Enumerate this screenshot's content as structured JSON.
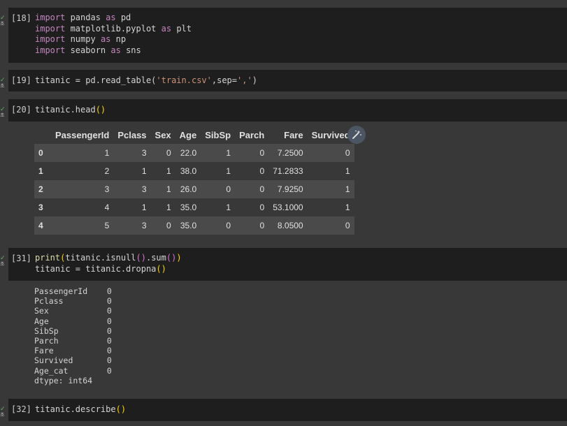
{
  "cells": [
    {
      "prompt": "[18]",
      "status": "✓",
      "time": "초",
      "lines": [
        [
          "import",
          " pandas ",
          "as",
          " pd"
        ],
        [
          "import",
          " matplotlib.pyplot ",
          "as",
          " plt"
        ],
        [
          "import",
          " numpy ",
          "as",
          " np"
        ],
        [
          "import",
          " seaborn ",
          "as",
          " sns"
        ]
      ]
    },
    {
      "prompt": "[19]",
      "status": "✓",
      "time": "초",
      "code_pre": "titanic = pd.read_table(",
      "code_str1": "'train.csv'",
      "code_mid": ",sep=",
      "code_str2": "','",
      "code_post": ")"
    },
    {
      "prompt": "[20]",
      "status": "✓",
      "time": "초",
      "code_pre": "titanic.head",
      "code_paren": "()"
    },
    {
      "prompt": "[31]",
      "status": "✓",
      "time": "초",
      "line1_fn": "print",
      "line1_open": "(",
      "line1_mid": "titanic.isnull",
      "line1_p2": "()",
      "line1_mid2": ".sum",
      "line1_p3": "()",
      "line1_close": ")",
      "line2_pre": "titanic = titanic.dropna",
      "line2_paren": "()"
    },
    {
      "prompt": "[32]",
      "status": "✓",
      "time": "초",
      "code_pre": "titanic.describe",
      "code_paren": "()"
    }
  ],
  "dataframe": {
    "columns": [
      "",
      "PassengerId",
      "Pclass",
      "Sex",
      "Age",
      "SibSp",
      "Parch",
      "Fare",
      "Survived"
    ],
    "rows": [
      [
        "0",
        "1",
        "3",
        "0",
        "22.0",
        "1",
        "0",
        "7.2500",
        "0"
      ],
      [
        "1",
        "2",
        "1",
        "1",
        "38.0",
        "1",
        "0",
        "71.2833",
        "1"
      ],
      [
        "2",
        "3",
        "3",
        "1",
        "26.0",
        "0",
        "0",
        "7.9250",
        "1"
      ],
      [
        "3",
        "4",
        "1",
        "1",
        "35.0",
        "1",
        "0",
        "53.1000",
        "1"
      ],
      [
        "4",
        "5",
        "3",
        "0",
        "35.0",
        "0",
        "0",
        "8.0500",
        "0"
      ]
    ]
  },
  "magic_icon": "magic-wand-icon",
  "stdout_lines": [
    "PassengerId    0",
    "Pclass         0",
    "Sex            0",
    "Age            0",
    "SibSp          0",
    "Parch          0",
    "Fare           0",
    "Survived       0",
    "Age_cat        0",
    "dtype: int64"
  ]
}
